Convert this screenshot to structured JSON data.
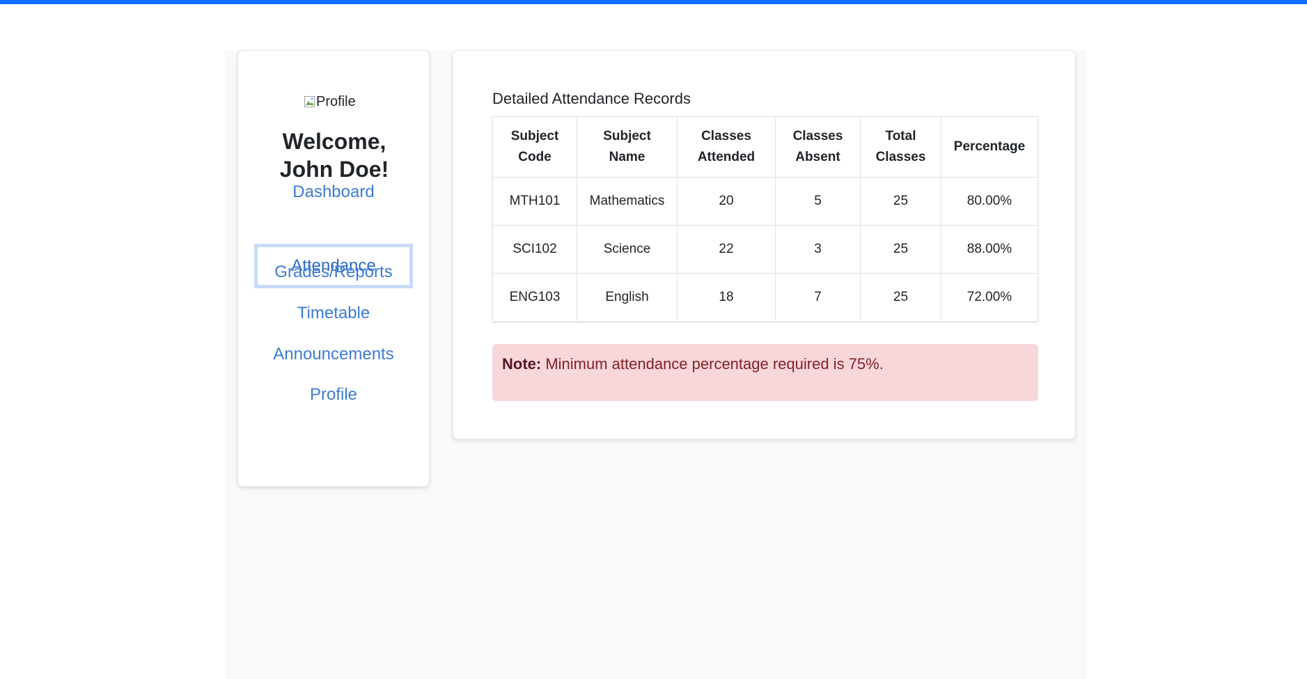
{
  "colors": {
    "top_bar": "#0d6efd",
    "link": "#3d7bd4",
    "active_border": "#c7dbf8",
    "alert_bg": "#f8d7da",
    "alert_text": "#842029"
  },
  "sidebar": {
    "profile_image_alt": "Profile",
    "welcome_line1": "Welcome,",
    "welcome_line2": "John Doe!",
    "nav": [
      {
        "label": "Dashboard",
        "active": false
      },
      {
        "label": "Attendance",
        "active": true
      },
      {
        "label": "Grades/Reports",
        "active": false
      },
      {
        "label": "Timetable",
        "active": false
      },
      {
        "label": "Announcements",
        "active": false
      },
      {
        "label": "Profile",
        "active": false
      }
    ]
  },
  "main": {
    "title": "Detailed Attendance Records",
    "table": {
      "headers": [
        [
          "Subject",
          "Code"
        ],
        [
          "Subject",
          "Name"
        ],
        [
          "Classes",
          "Attended"
        ],
        [
          "Classes",
          "Absent"
        ],
        [
          "Total",
          "Classes"
        ],
        [
          "Percentage",
          ""
        ]
      ],
      "rows": [
        [
          "MTH101",
          "Mathematics",
          "20",
          "5",
          "25",
          "80.00%"
        ],
        [
          "SCI102",
          "Science",
          "22",
          "3",
          "25",
          "88.00%"
        ],
        [
          "ENG103",
          "English",
          "18",
          "7",
          "25",
          "72.00%"
        ]
      ]
    },
    "note": {
      "label": "Note:",
      "text": " Minimum attendance percentage required is 75%."
    }
  }
}
